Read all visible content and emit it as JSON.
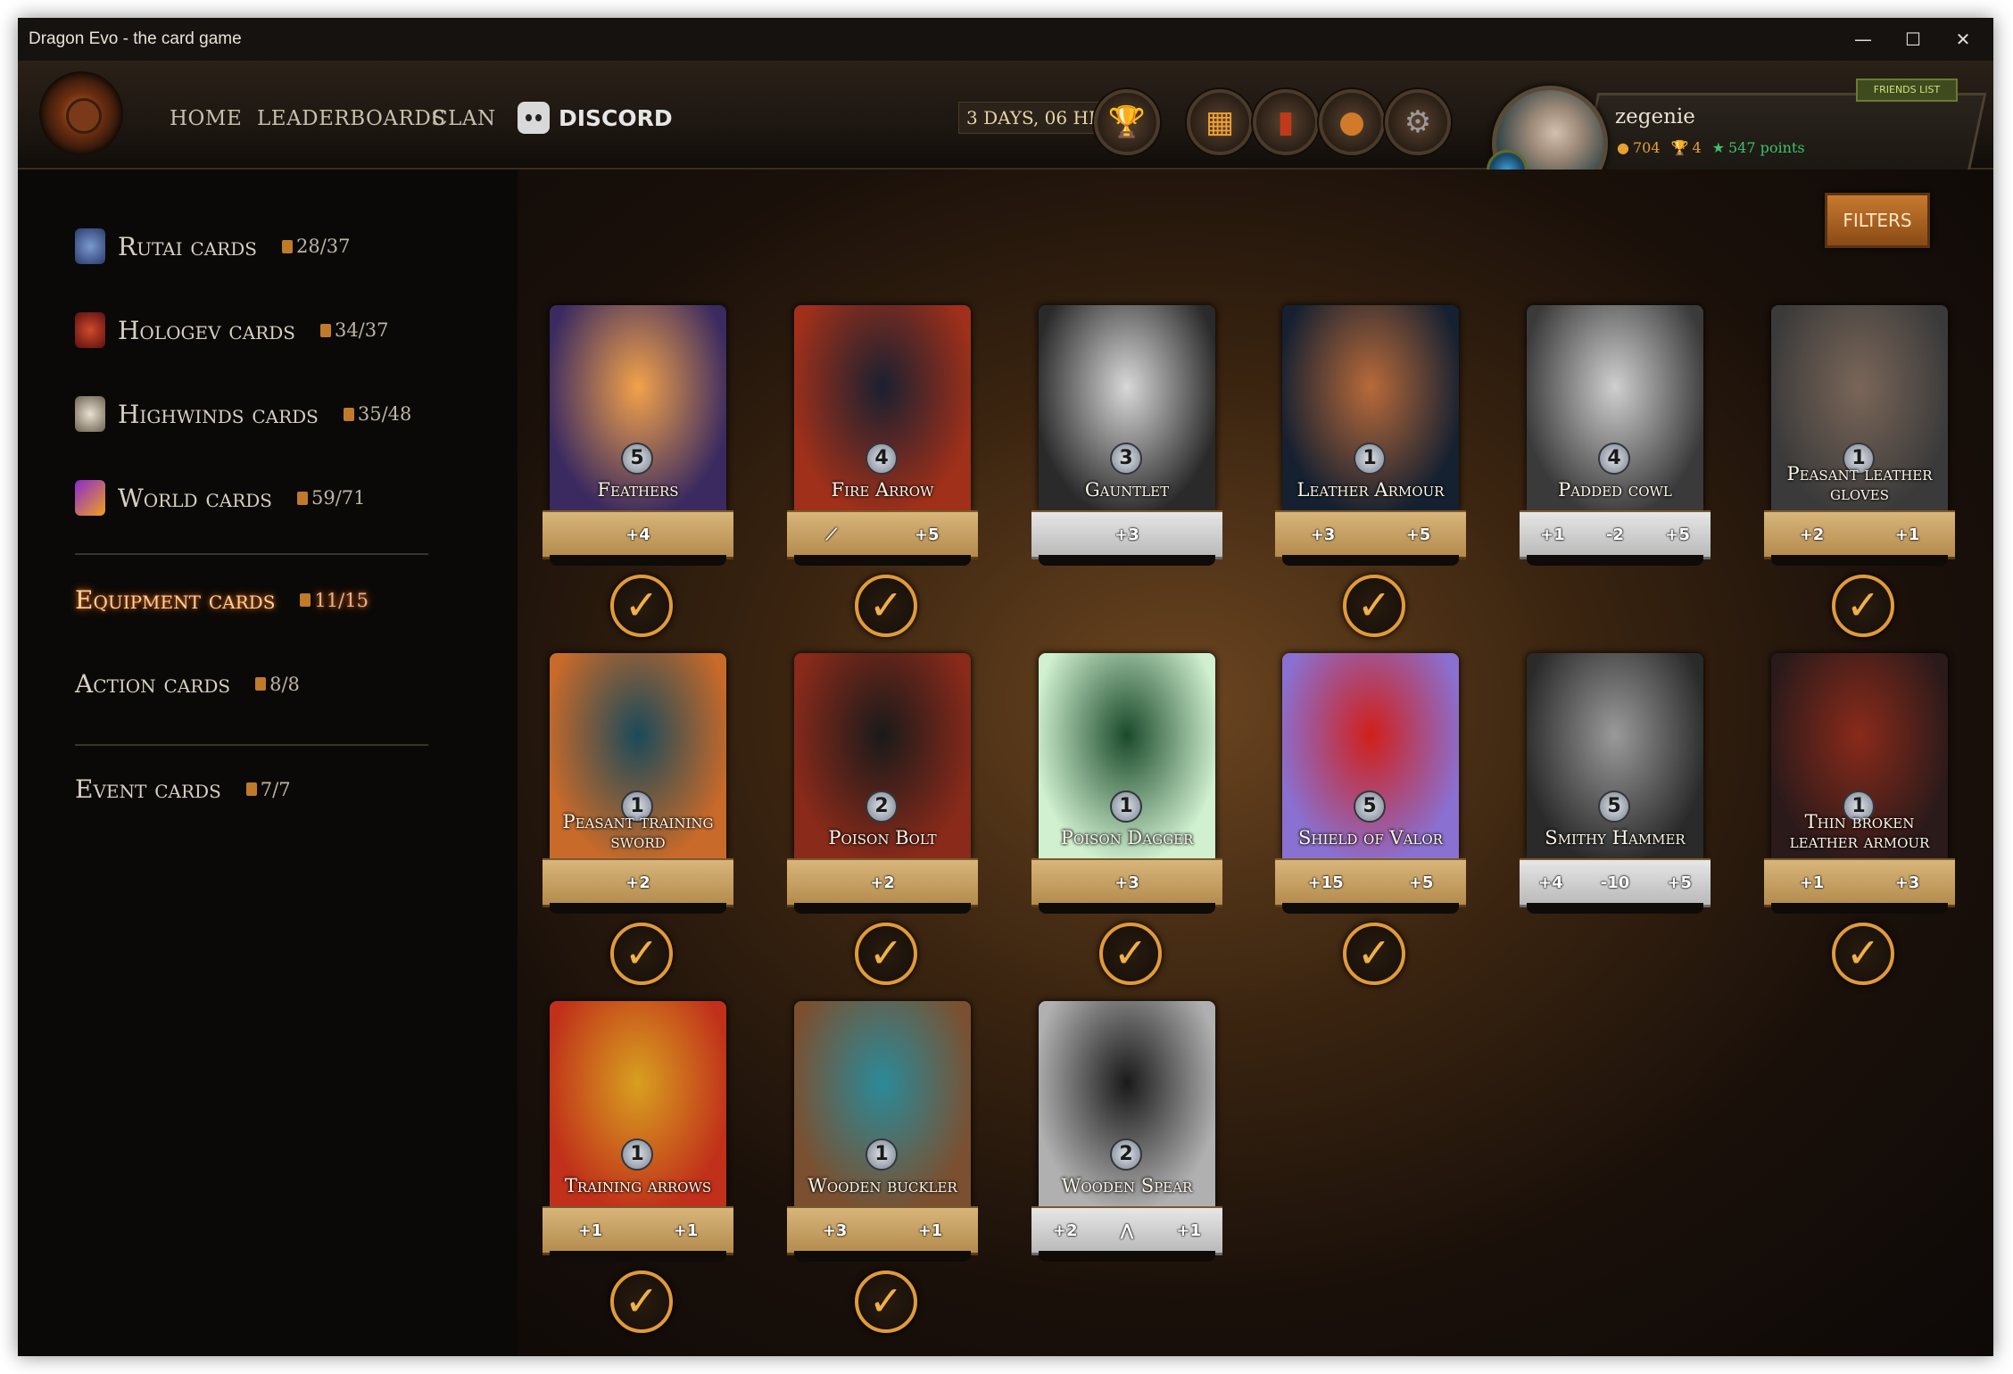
{
  "window": {
    "title": "Dragon Evo - the card game",
    "controls": [
      "—",
      "☐",
      "✕"
    ]
  },
  "nav": {
    "items": [
      "HOME",
      "LEADERBOARDS",
      "CLAN"
    ],
    "discord_label": "DISCORD",
    "timer": "3 DAYS, 06 HRS",
    "icon_buttons": [
      "trophy-icon",
      "cards-icon",
      "book-icon",
      "bag-icon",
      "gear-icon"
    ]
  },
  "profile": {
    "username": "zegenie",
    "coins": "704",
    "trophies": "4",
    "points": "547 points",
    "friends_label": "FRIENDS LIST"
  },
  "sidebar": {
    "categories": [
      {
        "label": "Rutai cards",
        "count": "28/37",
        "color": "#4a6aa8"
      },
      {
        "label": "Hologev cards",
        "count": "34/37",
        "color": "#b0281c"
      },
      {
        "label": "Highwinds cards",
        "count": "35/48",
        "color": "#d0c8b8"
      },
      {
        "label": "World cards",
        "count": "59/71",
        "color": "#c04080"
      },
      {
        "label": "Equipment cards",
        "count": "11/15",
        "active": true
      },
      {
        "label": "Action cards",
        "count": "8/8"
      },
      {
        "label": "Event cards",
        "count": "7/7"
      }
    ]
  },
  "filters_label": "FILTERS",
  "cards": [
    {
      "name": "Feathers",
      "cost": "5",
      "stats": [
        "+4"
      ],
      "bar": "gold",
      "owned": true,
      "bg": [
        "#f2a24a",
        "#3a2a60"
      ]
    },
    {
      "name": "Fire Arrow",
      "cost": "4",
      "stats": [
        "⟋",
        "+5"
      ],
      "bar": "gold",
      "owned": true,
      "bg": [
        "#1a2030",
        "#a0301a"
      ]
    },
    {
      "name": "Gauntlet",
      "cost": "3",
      "stats": [
        "+3"
      ],
      "bar": "silver",
      "owned": false,
      "bg": [
        "#d8d8d8",
        "#2a2a2a"
      ]
    },
    {
      "name": "Leather Armour",
      "cost": "1",
      "stats": [
        "+3",
        "+5"
      ],
      "bar": "gold",
      "owned": true,
      "bg": [
        "#b86a3a",
        "#152030"
      ]
    },
    {
      "name": "Padded cowl",
      "cost": "4",
      "stats": [
        "+1",
        "-2",
        "+5"
      ],
      "bar": "silver",
      "owned": false,
      "bg": [
        "#cfcfcf",
        "#3a3a3a"
      ]
    },
    {
      "name": "Peasant leather gloves",
      "cost": "1",
      "stats": [
        "+2",
        "+1"
      ],
      "bar": "gold",
      "owned": true,
      "bg": [
        "#7a6658",
        "#3a3a3a"
      ]
    },
    {
      "name": "Peasant training sword",
      "cost": "1",
      "stats": [
        "+2"
      ],
      "bar": "gold",
      "owned": true,
      "bg": [
        "#1a4a5a",
        "#c86a2a"
      ]
    },
    {
      "name": "Poison Bolt",
      "cost": "2",
      "stats": [
        "+2"
      ],
      "bar": "gold",
      "owned": true,
      "bg": [
        "#1a1a1a",
        "#8a2a1a"
      ]
    },
    {
      "name": "Poison Dagger",
      "cost": "1",
      "stats": [
        "+3"
      ],
      "bar": "gold",
      "owned": true,
      "bg": [
        "#1a4a2a",
        "#d0f0d0"
      ]
    },
    {
      "name": "Shield of Valor",
      "cost": "5",
      "stats": [
        "+15",
        "+5"
      ],
      "bar": "gold",
      "owned": true,
      "bg": [
        "#d0201a",
        "#8a70d0"
      ]
    },
    {
      "name": "Smithy Hammer",
      "cost": "5",
      "stats": [
        "+4",
        "-10",
        "+5"
      ],
      "bar": "silver",
      "owned": false,
      "bg": [
        "#9a9a9a",
        "#2a2a2a"
      ]
    },
    {
      "name": "Thin broken leather armour",
      "cost": "1",
      "stats": [
        "+1",
        "+3"
      ],
      "bar": "gold",
      "owned": true,
      "bg": [
        "#8a2a1a",
        "#2a1a1a"
      ]
    },
    {
      "name": "Training arrows",
      "cost": "1",
      "stats": [
        "+1",
        "+1"
      ],
      "bar": "gold",
      "owned": true,
      "bg": [
        "#d8a020",
        "#c0301a"
      ]
    },
    {
      "name": "Wooden buckler",
      "cost": "1",
      "stats": [
        "+3",
        "+1"
      ],
      "bar": "gold",
      "owned": true,
      "bg": [
        "#2a8a9a",
        "#7a5030"
      ]
    },
    {
      "name": "Wooden Spear",
      "cost": "2",
      "stats": [
        "+2",
        "⋀",
        "+1"
      ],
      "bar": "silver",
      "owned": false,
      "bg": [
        "#1a1a1a",
        "#b0b0b0"
      ]
    }
  ]
}
